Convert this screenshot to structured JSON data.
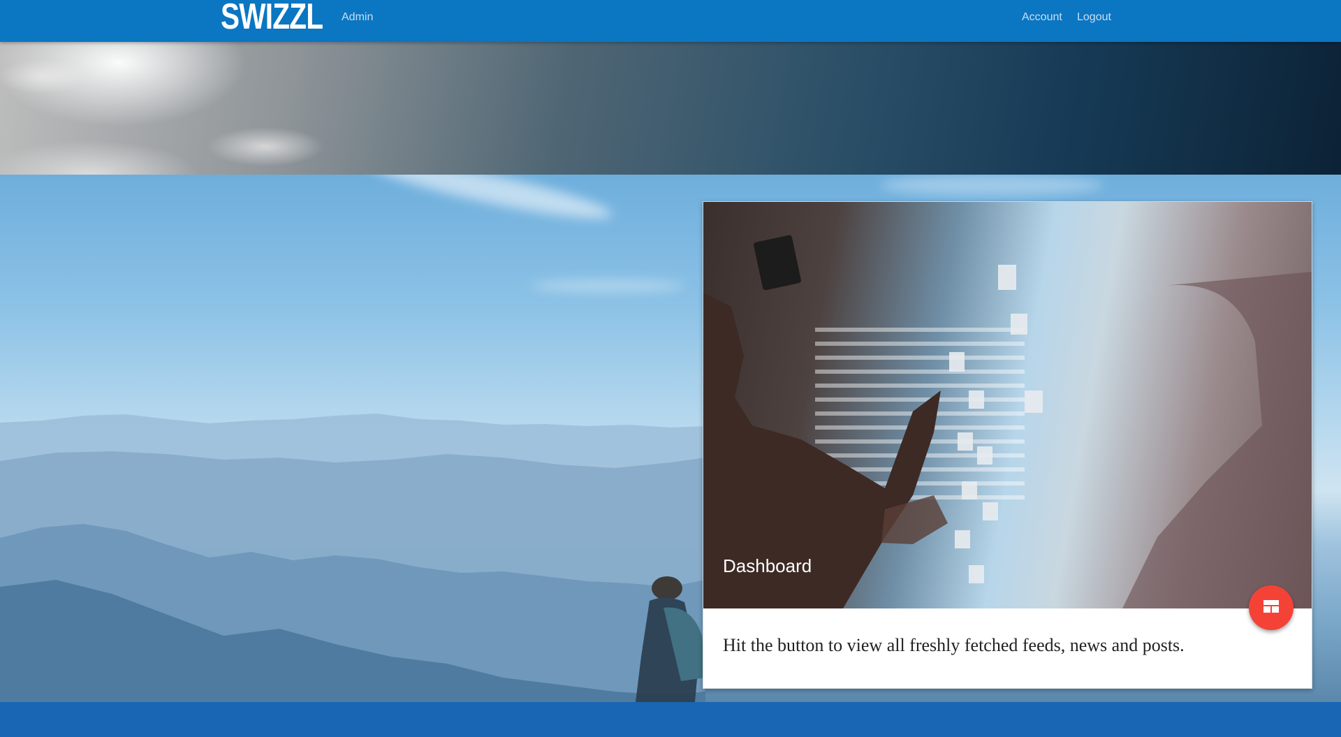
{
  "navbar": {
    "brand": "SWIZZL",
    "admin_label": "Admin",
    "account_label": "Account",
    "logout_label": "Logout"
  },
  "card": {
    "title": "Dashboard",
    "text": "Hit the button to view all freshly fetched feeds, news and posts.",
    "fab_icon": "view-dashboard-icon"
  },
  "colors": {
    "navbar": "#0b76c2",
    "footer": "#1866b4",
    "fab": "#f44336"
  }
}
